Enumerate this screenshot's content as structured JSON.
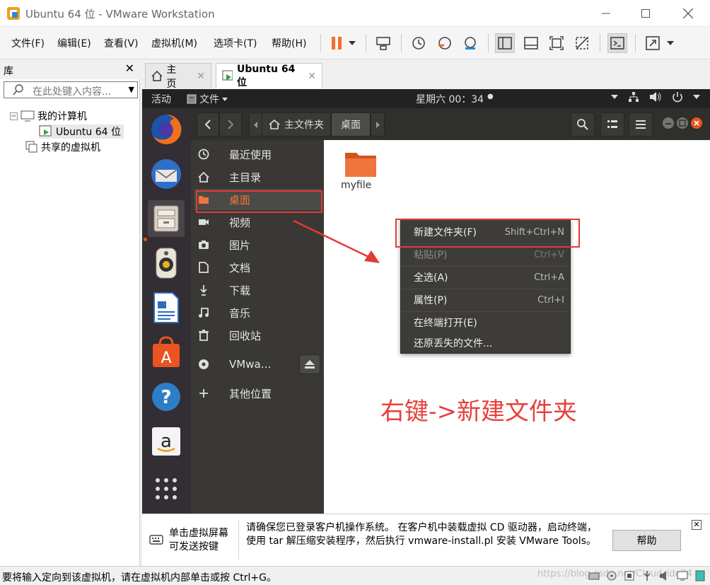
{
  "window": {
    "title": "Ubuntu 64 位 - VMware Workstation"
  },
  "menu": {
    "items": [
      "文件(F)",
      "编辑(E)",
      "查看(V)",
      "虚拟机(M)",
      "选项卡(T)",
      "帮助(H)"
    ]
  },
  "library": {
    "title": "库",
    "search_placeholder": "在此处键入内容...",
    "tree": {
      "my_computer": "我的计算机",
      "vm": "Ubuntu 64 位",
      "shared": "共享的虚拟机"
    }
  },
  "tabs": [
    {
      "label": "主页"
    },
    {
      "label": "Ubuntu 64 位"
    }
  ],
  "guest": {
    "topbar": {
      "activities": "活动",
      "files_menu": "文件",
      "clock": "星期六 00：34"
    },
    "path": {
      "home": "主文件夹",
      "current": "桌面"
    },
    "sidebar": [
      {
        "label": "最近使用",
        "icon": "clock-icon"
      },
      {
        "label": "主目录",
        "icon": "home-icon"
      },
      {
        "label": "桌面",
        "icon": "folder-icon"
      },
      {
        "label": "视频",
        "icon": "video-icon"
      },
      {
        "label": "图片",
        "icon": "camera-icon"
      },
      {
        "label": "文档",
        "icon": "document-icon"
      },
      {
        "label": "下载",
        "icon": "download-icon"
      },
      {
        "label": "音乐",
        "icon": "music-icon"
      },
      {
        "label": "回收站",
        "icon": "trash-icon"
      },
      {
        "label": "VMwa…",
        "icon": "disc-icon"
      },
      {
        "label": "其他位置",
        "icon": "plus-icon"
      }
    ],
    "files": [
      {
        "name": "myfile"
      }
    ],
    "context_menu": [
      {
        "label": "新建文件夹(F)",
        "shortcut": "Shift+Ctrl+N",
        "enabled": true
      },
      {
        "label": "粘贴(P)",
        "shortcut": "Ctrl+V",
        "enabled": false
      },
      {
        "label": "全选(A)",
        "shortcut": "Ctrl+A",
        "enabled": true
      },
      {
        "label": "属性(P)",
        "shortcut": "Ctrl+I",
        "enabled": true
      },
      {
        "label": "在终端打开(E)",
        "shortcut": "",
        "enabled": true
      },
      {
        "label": "还原丢失的文件...",
        "shortcut": "",
        "enabled": true
      }
    ],
    "annotation": "右键->新建文件夹"
  },
  "notification": {
    "click_hint": "单击虚拟屏幕\n可发送按键",
    "message": "请确保您已登录客户机操作系统。 在客户机中装载虚拟 CD 驱动器，启动终端，使用 tar 解压缩安装程序，然后执行 vmware-install.pl 安装 VMware Tools。",
    "help": "帮助"
  },
  "status": {
    "text": "要将输入定向到该虚拟机，请在虚拟机内部单击或按 Ctrl+G。",
    "watermark": "https://blog.csdn.net/Cloud_ide04"
  },
  "colors": {
    "ubuntu_orange": "#e95420",
    "annotation_red": "#e23b36"
  }
}
